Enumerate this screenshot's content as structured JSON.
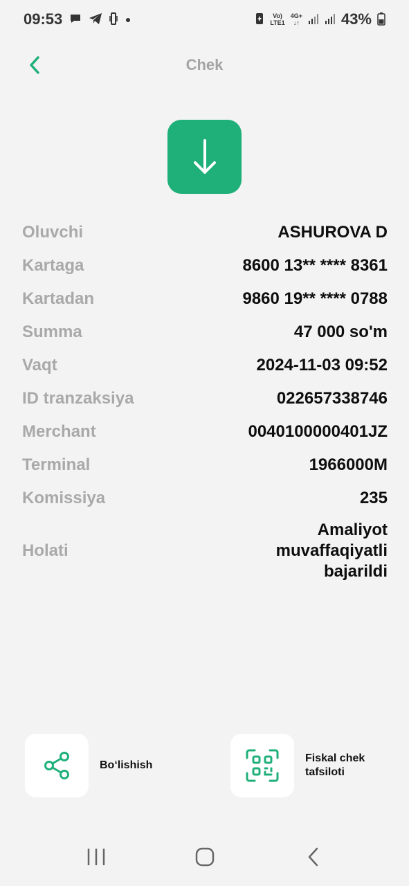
{
  "status_bar": {
    "time": "09:53",
    "network_top": "Vo)",
    "network_bottom": "LTE1",
    "net2_top": "4G+",
    "battery": "43%"
  },
  "header": {
    "title": "Chek",
    "back_icon": "chevron-left-icon"
  },
  "download": {
    "icon": "arrow-down-icon",
    "color": "#1fb07a"
  },
  "details": [
    {
      "label": "Oluvchi",
      "value": "ASHUROVA D"
    },
    {
      "label": "Kartaga",
      "value": "8600 13** **** 8361"
    },
    {
      "label": "Kartadan",
      "value": "9860 19** **** 0788"
    },
    {
      "label": "Summa",
      "value": "47 000 so'm"
    },
    {
      "label": "Vaqt",
      "value": "2024-11-03 09:52"
    },
    {
      "label": "ID tranzaksiya",
      "value": "022657338746"
    },
    {
      "label": "Merchant",
      "value": "0040100000401JZ"
    },
    {
      "label": "Terminal",
      "value": "1966000M"
    },
    {
      "label": "Komissiya",
      "value": "235"
    },
    {
      "label": "Holati",
      "value": "Amaliyot muvaffaqiyatli bajarildi"
    }
  ],
  "actions": {
    "share": {
      "label": "Bo‘lishish",
      "icon": "share-icon"
    },
    "fiscal": {
      "label": "Fiskal chek tafsiloti",
      "icon": "qr-scan-icon"
    }
  },
  "accent_color": "#1fb07a"
}
